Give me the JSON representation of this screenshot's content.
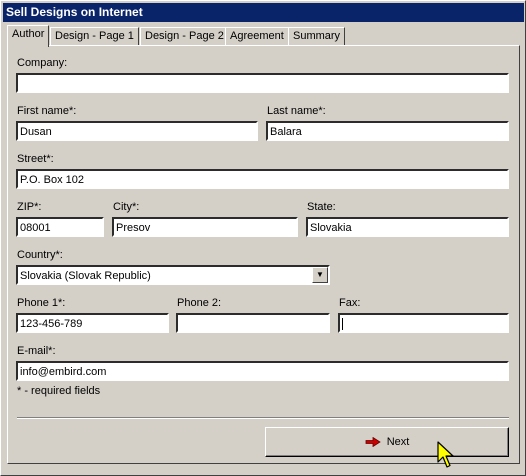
{
  "window": {
    "title": "Sell Designs on Internet"
  },
  "tabs": [
    {
      "label": "Author"
    },
    {
      "label": "Design - Page 1"
    },
    {
      "label": "Design - Page 2"
    },
    {
      "label": "Agreement"
    },
    {
      "label": "Summary"
    }
  ],
  "form": {
    "company": {
      "label": "Company:",
      "value": ""
    },
    "first_name": {
      "label": "First name*:",
      "value": "Dusan"
    },
    "last_name": {
      "label": "Last name*:",
      "value": "Balara"
    },
    "street": {
      "label": "Street*:",
      "value": "P.O. Box 102"
    },
    "zip": {
      "label": "ZIP*:",
      "value": "08001"
    },
    "city": {
      "label": "City*:",
      "value": "Presov"
    },
    "state": {
      "label": "State:",
      "value": "Slovakia"
    },
    "country": {
      "label": "Country*:",
      "value": "Slovakia (Slovak Republic)"
    },
    "phone1": {
      "label": "Phone 1*:",
      "value": "123-456-789"
    },
    "phone2": {
      "label": "Phone 2:",
      "value": ""
    },
    "fax": {
      "label": "Fax:",
      "value": ""
    },
    "email": {
      "label": "E-mail*:",
      "value": "info@embird.com"
    },
    "required_note": "* - required fields"
  },
  "buttons": {
    "next": "Next"
  },
  "colors": {
    "titlebar": "#0a246a",
    "face": "#d4d0c8",
    "arrow": "#cc0000",
    "cursor": "#ffff00"
  }
}
